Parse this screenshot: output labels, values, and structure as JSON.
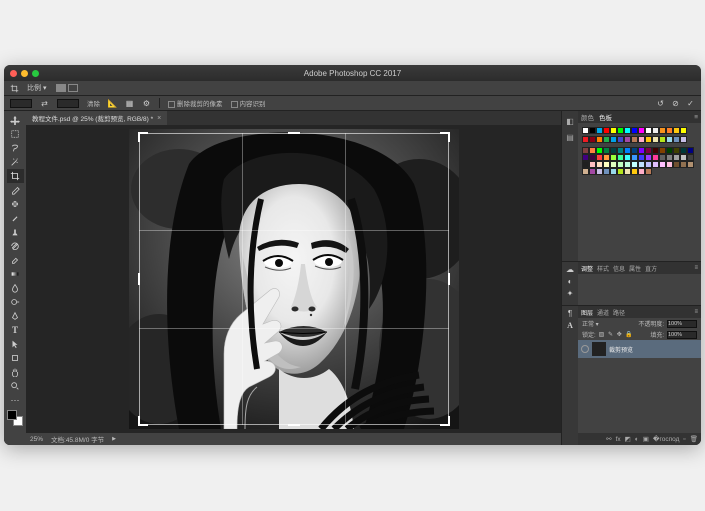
{
  "app": {
    "title": "Adobe Photoshop CC 2017"
  },
  "menu": {
    "tool_label": "比例"
  },
  "options_bar": {
    "clear_label": "清除",
    "delete_cropped": "删除裁剪的像素",
    "content_aware": "内容识别"
  },
  "doc_tab": {
    "label": "教程文件.psd @ 25% (裁剪预览, RGB/8) *"
  },
  "status": {
    "zoom": "25%",
    "doc_info": "文档:45.8M/0 字节"
  },
  "swatches": {
    "tab1": "颜色",
    "tab2": "色板",
    "row1": [
      "#ffffff",
      "#000000",
      "#00a8e8",
      "#ff0000",
      "#ffff00",
      "#00ff00",
      "#00ffff",
      "#0000ff",
      "#ff00ff",
      "#ffffff",
      "#eeeeee",
      "#f7931e",
      "#ff7f27",
      "#ffc90e",
      "#ffff00"
    ],
    "row2": [
      "#ed1c24",
      "#880015",
      "#ff7f00",
      "#22b14c",
      "#00a2e8",
      "#3f48cc",
      "#a349a4",
      "#b97a57",
      "#ffaec9",
      "#ffc90e",
      "#efe4b0",
      "#b5e61d",
      "#99d9ea",
      "#7092be",
      "#c8bfe7"
    ],
    "grid": [
      "#804040",
      "#ff8040",
      "#00ff00",
      "#008040",
      "#004040",
      "#008080",
      "#0080ff",
      "#004080",
      "#8000ff",
      "#800040",
      "#400000",
      "#804000",
      "#004000",
      "#404000",
      "#003838",
      "#000080",
      "#400080",
      "#400040",
      "#ff3c3c",
      "#ff9a3c",
      "#9aff3c",
      "#3cff9a",
      "#3cffff",
      "#3c9aff",
      "#3c3cff",
      "#9a3cff",
      "#ff3c9a",
      "#606060",
      "#808080",
      "#a0a0a0",
      "#c0c0c0",
      "#404040",
      "#202020",
      "#ffc0c0",
      "#ffe0c0",
      "#ffffc0",
      "#e0ffc0",
      "#c0ffc0",
      "#c0ffe0",
      "#c0ffff",
      "#c0e0ff",
      "#c0c0ff",
      "#e0c0ff",
      "#ffc0ff",
      "#ffc0e0",
      "#705030",
      "#907050",
      "#b09070",
      "#d0b090",
      "#a349a4",
      "#c8bfe7",
      "#7092be",
      "#99d9ea",
      "#b5e61d",
      "#efe4b0",
      "#ffc90e",
      "#ffaec9",
      "#b97a57"
    ]
  },
  "prop_panel": {
    "tabs": [
      "调整",
      "样式",
      "信息",
      "属性",
      "直方"
    ]
  },
  "layers": {
    "tabs": [
      "图层",
      "通道",
      "路径"
    ],
    "blend_label": "正常",
    "opacity_label": "不透明度:",
    "opacity_value": "100%",
    "lock_label": "锁定:",
    "fill_label": "填充:",
    "fill_value": "100%",
    "layer_name": "裁剪预览"
  }
}
